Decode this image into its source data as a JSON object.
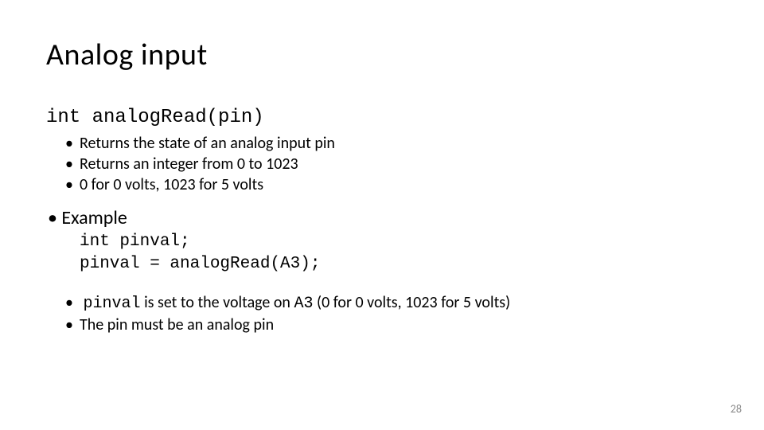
{
  "title": "Analog input",
  "signature": "int analogRead(pin)",
  "sig_bullets": [
    "Returns the state of an analog input pin",
    "Returns an integer from 0 to 1023",
    "0 for 0 volts, 1023 for 5 volts"
  ],
  "example_label": "Example",
  "code": {
    "line1": "int pinval;",
    "line2": "pinval = analogRead(A3);"
  },
  "explain": {
    "b1_code1": "pinval",
    "b1_mid": " is set to the voltage on ",
    "b1_code2": "A3",
    "b1_tail": " (0 for 0 volts, 1023 for 5 volts)",
    "b2": "The pin must be an analog pin"
  },
  "page_number": "28"
}
